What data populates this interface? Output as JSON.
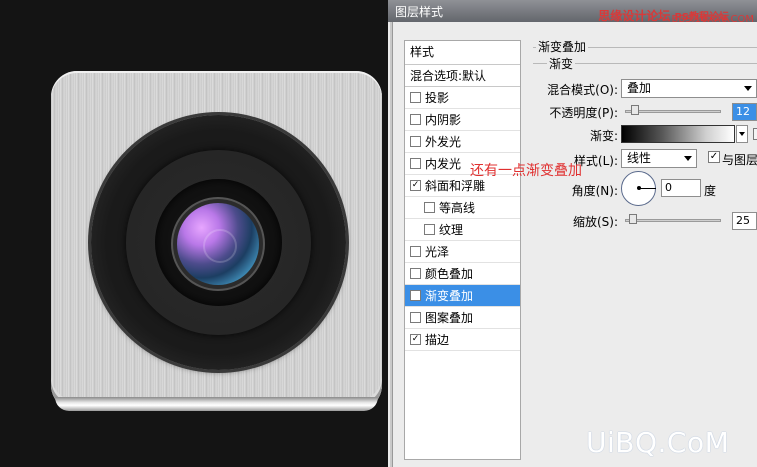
{
  "dialog": {
    "title": "图层样式",
    "watermark_site": "思缘设计论坛",
    "watermark_ps": "PS教程论坛",
    "watermark_url": "BBS.16XX8.COM"
  },
  "styles_panel": {
    "header": "样式",
    "blend_default": "混合选项:默认",
    "items": [
      {
        "label": "投影",
        "checked": false,
        "indent": false,
        "selected": false
      },
      {
        "label": "内阴影",
        "checked": false,
        "indent": false,
        "selected": false
      },
      {
        "label": "外发光",
        "checked": false,
        "indent": false,
        "selected": false
      },
      {
        "label": "内发光",
        "checked": false,
        "indent": false,
        "selected": false
      },
      {
        "label": "斜面和浮雕",
        "checked": true,
        "indent": false,
        "selected": false
      },
      {
        "label": "等高线",
        "checked": false,
        "indent": true,
        "selected": false
      },
      {
        "label": "纹理",
        "checked": false,
        "indent": true,
        "selected": false
      },
      {
        "label": "光泽",
        "checked": false,
        "indent": false,
        "selected": false
      },
      {
        "label": "颜色叠加",
        "checked": false,
        "indent": false,
        "selected": false
      },
      {
        "label": "渐变叠加",
        "checked": true,
        "indent": false,
        "selected": true
      },
      {
        "label": "图案叠加",
        "checked": false,
        "indent": false,
        "selected": false
      },
      {
        "label": "描边",
        "checked": true,
        "indent": false,
        "selected": false
      }
    ]
  },
  "gradient_overlay": {
    "section_title": "渐变叠加",
    "subsection_title": "渐变",
    "blend_mode_label": "混合模式(O):",
    "blend_mode_value": "叠加",
    "opacity_label": "不透明度(P):",
    "opacity_value": "12",
    "gradient_label": "渐变:",
    "style_label": "样式(L):",
    "style_value": "线性",
    "align_label": "与图层",
    "align_checked": true,
    "angle_label": "角度(N):",
    "angle_value": "0",
    "angle_unit": "度",
    "scale_label": "缩放(S):",
    "scale_value": "25"
  },
  "annotation": "还有一点渐变叠加",
  "brand": "UiBQ.CoM"
}
